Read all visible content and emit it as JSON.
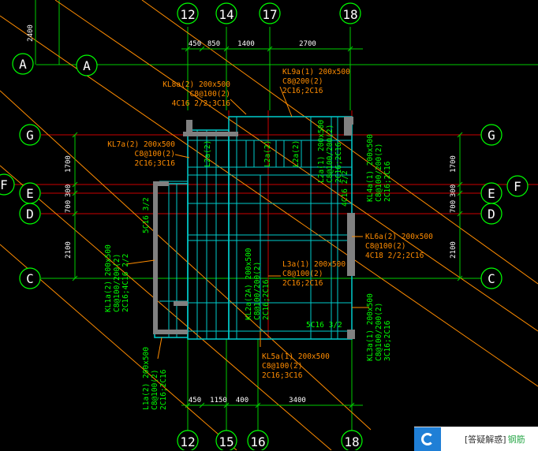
{
  "colors": {
    "background": "#000000",
    "axis_line": "#00cc00",
    "dimension": "#00cc00",
    "red_axis": "#cc0000",
    "beam": "#00cccc",
    "column": "#808080",
    "label_orange": "#ff8c00",
    "label_green": "#00ff00",
    "diagonal": "#ff8c00",
    "bubble": "#00ff00",
    "white_text": "#ffffff"
  },
  "axes": {
    "top": [
      "12",
      "14",
      "17",
      "18"
    ],
    "bottom": [
      "12",
      "15",
      "16",
      "18"
    ],
    "left": [
      "A",
      "A",
      "G",
      "F",
      "E",
      "D",
      "C"
    ],
    "right": [
      "G",
      "F",
      "E",
      "D",
      "C"
    ]
  },
  "dimensions": {
    "top": [
      "450",
      "850",
      "1400",
      "2700"
    ],
    "bottom": [
      "450",
      "1150",
      "400",
      "3400"
    ],
    "left": [
      "2400",
      "1700",
      "300",
      "700",
      "2100"
    ],
    "right": [
      "1700",
      "300",
      "700",
      "2100"
    ]
  },
  "beam_labels": {
    "KL9a": [
      "KL9a(1) 200x500",
      "C8@200(2)",
      "2C16;2C16"
    ],
    "KL8a": [
      "KL8a(2) 200x500",
      "C8@100(2)",
      "4C16 2/2;3C16"
    ],
    "KL7a": [
      "KL7a(2) 200x500",
      "C8@100(2)",
      "2C16;3C16"
    ],
    "KL6a": [
      "KL6a(2) 200x500",
      "C8@100(2)",
      "4C18 2/2;2C16"
    ],
    "L3a": [
      "L3a(1) 200x500",
      "C8@100(2)",
      "2C16;2C16"
    ],
    "KL5a": [
      "KL5a(1) 200x500",
      "C8@100(2)",
      "2C16;3C16"
    ],
    "KL1a": [
      "KL1a(2) 200x500",
      "C8@100/200(2)",
      "2C16;4C16 2/2"
    ],
    "KL2a": [
      "KL2a(2A) 200x500",
      "C8@100/200(2)",
      "2C16;2C16"
    ],
    "L1a": [
      "L1a(2) 200x500",
      "C8@100(2)",
      "2C16;2C16"
    ],
    "KL3a": [
      "KL3a(1) 200x500",
      "C8@100/200(2)",
      "3C16;2C16"
    ],
    "KL4a": [
      "KL4a(1) 200x500",
      "C8@100/200(2)",
      "2C16;2C16"
    ],
    "L2a_right": [
      "L2a(1) 200x500",
      "C8@100/200(2)",
      "2C16;2C16"
    ]
  },
  "small_labels": {
    "l2a_1": "L2a(2)",
    "l2a_2": "L2a(2)",
    "l2a_3": "L2a(2)",
    "left_rebar": "5C16 3/2",
    "bottom_rebar": "5C16 3/2",
    "right_rebar": "4C16 2/2"
  },
  "badge": {
    "text": "[答疑解惑]",
    "accent": "钢筋"
  }
}
